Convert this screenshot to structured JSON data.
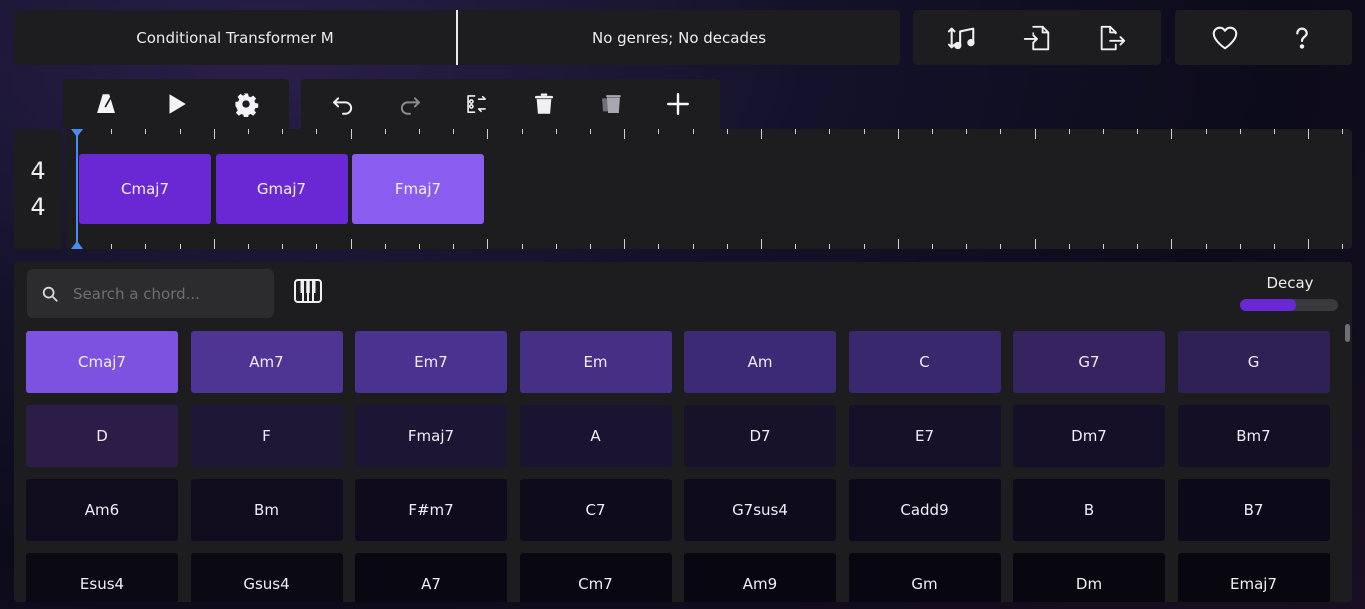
{
  "header": {
    "model_name": "Conditional Transformer M",
    "filters": "No genres; No decades"
  },
  "icons": {
    "transpose": "transpose-music-icon",
    "import": "import-file-icon",
    "export": "export-file-icon",
    "favorite": "heart-icon",
    "help": "question-icon",
    "metronome": "metronome-icon",
    "play": "play-icon",
    "settings": "gear-icon",
    "undo": "undo-icon",
    "redo": "redo-icon",
    "replace": "replace-chord-icon",
    "delete": "trash-icon",
    "delete_all": "trash-all-icon",
    "add": "plus-icon",
    "search": "search-icon",
    "piano": "piano-keyboard-icon"
  },
  "time_signature": {
    "top": "4",
    "bottom": "4"
  },
  "progression": [
    {
      "label": "Cmaj7",
      "color": "#6a28d4"
    },
    {
      "label": "Gmaj7",
      "color": "#6a28d4"
    },
    {
      "label": "Fmaj7",
      "color": "#8a5cf0"
    }
  ],
  "search": {
    "placeholder": "Search a chord..."
  },
  "decay": {
    "label": "Decay",
    "value": 0.57,
    "color": "#6a28d4"
  },
  "suggestions": [
    {
      "label": "Cmaj7",
      "color": "#7e52e0"
    },
    {
      "label": "Am7",
      "color": "#4e3493"
    },
    {
      "label": "Em7",
      "color": "#4a3290"
    },
    {
      "label": "Em",
      "color": "#463086"
    },
    {
      "label": "Am",
      "color": "#3d2a76"
    },
    {
      "label": "C",
      "color": "#3a286f"
    },
    {
      "label": "G7",
      "color": "#35245f"
    },
    {
      "label": "G",
      "color": "#2f2155"
    },
    {
      "label": "D",
      "color": "#2b1d48"
    },
    {
      "label": "F",
      "color": "#1e1736"
    },
    {
      "label": "Fmaj7",
      "color": "#1c1533"
    },
    {
      "label": "A",
      "color": "#1a1430"
    },
    {
      "label": "D7",
      "color": "#17122a"
    },
    {
      "label": "E7",
      "color": "#161128"
    },
    {
      "label": "Dm7",
      "color": "#151027"
    },
    {
      "label": "Bm7",
      "color": "#140f25"
    },
    {
      "label": "Am6",
      "color": "#100c1e"
    },
    {
      "label": "Bm",
      "color": "#100c1e"
    },
    {
      "label": "F#m7",
      "color": "#0f0b1c"
    },
    {
      "label": "C7",
      "color": "#0e0b1b"
    },
    {
      "label": "G7sus4",
      "color": "#0e0b1b"
    },
    {
      "label": "Cadd9",
      "color": "#0d0a19"
    },
    {
      "label": "B",
      "color": "#0d0a19"
    },
    {
      "label": "B7",
      "color": "#0c0a18"
    },
    {
      "label": "Esus4",
      "color": "#0a0914"
    },
    {
      "label": "Gsus4",
      "color": "#0a0914"
    },
    {
      "label": "A7",
      "color": "#090812"
    },
    {
      "label": "Cm7",
      "color": "#090812"
    },
    {
      "label": "Am9",
      "color": "#080711"
    },
    {
      "label": "Gm",
      "color": "#080711"
    },
    {
      "label": "Dm",
      "color": "#080710"
    },
    {
      "label": "Emaj7",
      "color": "#080710"
    }
  ]
}
